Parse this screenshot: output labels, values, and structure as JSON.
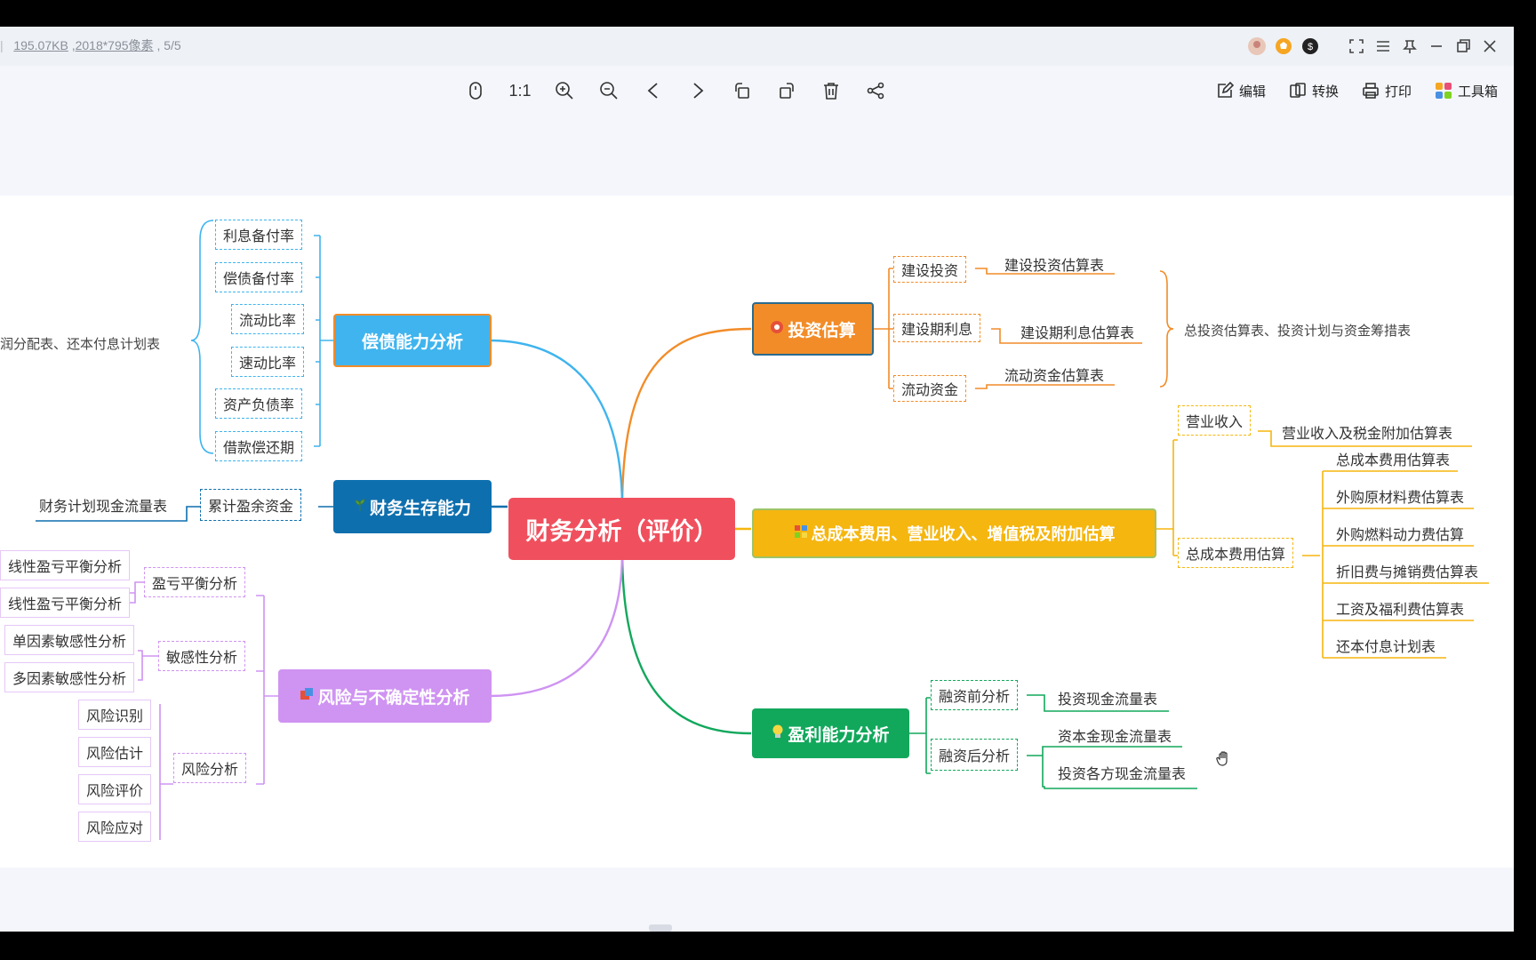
{
  "titlebar": {
    "file_size": "195.07KB",
    "dimensions": "2018*795像素",
    "page_info": ", 5/5"
  },
  "toolbar": {
    "actual_size_label": "1:1",
    "edit_label": "编辑",
    "convert_label": "转换",
    "print_label": "打印",
    "toolbox_label": "工具箱"
  },
  "mindmap": {
    "center": "财务分析（评价）",
    "investment": {
      "title": "投资估算",
      "subs": [
        "建设投资",
        "建设期利息",
        "流动资金"
      ],
      "leaves": [
        "建设投资估算表",
        "建设期利息估算表",
        "流动资金估算表"
      ],
      "summary": "总投资估算表、投资计划与资金筹措表"
    },
    "cost": {
      "title": "总成本费用、营业收入、增值税及附加估算",
      "subs": [
        "营业收入",
        "总成本费用估算"
      ],
      "revenue_leaf": "营业收入及税金附加估算表",
      "cost_leaves": [
        "总成本费用估算表",
        "外购原材料费估算表",
        "外购燃料动力费估算",
        "折旧费与摊销费估算表",
        "工资及福利费估算表",
        "还本付息计划表"
      ]
    },
    "profit": {
      "title": "盈利能力分析",
      "subs": [
        "融资前分析",
        "融资后分析"
      ],
      "leaves": [
        "投资现金流量表",
        "资本金现金流量表",
        "投资各方现金流量表"
      ]
    },
    "solvency": {
      "title": "偿债能力分析",
      "subs": [
        "利息备付率",
        "偿债备付率",
        "流动比率",
        "速动比率",
        "资产负债率",
        "借款偿还期"
      ],
      "summary": "润分配表、还本付息计划表"
    },
    "survival": {
      "title": "财务生存能力",
      "sub": "累计盈余资金",
      "leaf": "财务计划现金流量表"
    },
    "risk": {
      "title": "风险与不确定性分析",
      "subs": [
        "盈亏平衡分析",
        "敏感性分析",
        "风险分析"
      ],
      "breakeven_leaves": [
        "线性盈亏平衡分析",
        "线性盈亏平衡分析"
      ],
      "sensitivity_leaves": [
        "单因素敏感性分析",
        "多因素敏感性分析"
      ],
      "risk_leaves": [
        "风险识别",
        "风险估计",
        "风险评价",
        "风险应对"
      ]
    }
  },
  "colors": {
    "center": "#f0505e",
    "investment": "#f28c28",
    "cost": "#f5b60f",
    "profit": "#12a85c",
    "solvency": "#3fb4ee",
    "survival": "#0e6fae",
    "risk": "#cf93f2"
  }
}
